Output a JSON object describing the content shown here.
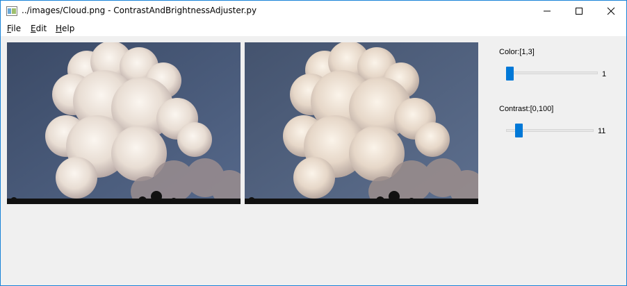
{
  "window": {
    "title": "../images/Cloud.png - ContrastAndBrightnessAdjuster.py",
    "icon": "app-window-icon",
    "controls": [
      "minimize-icon",
      "maximize-icon",
      "close-icon"
    ]
  },
  "menu": {
    "items": [
      {
        "accel": "F",
        "rest": "ile"
      },
      {
        "accel": "E",
        "rest": "dit"
      },
      {
        "accel": "H",
        "rest": "elp"
      }
    ]
  },
  "images": {
    "original": {
      "description_icon": "cloud-image"
    },
    "adjusted": {
      "description_icon": "cloud-image"
    }
  },
  "controls": {
    "color": {
      "label": "Color:[1,3]",
      "value": "1",
      "min": 1,
      "max": 3,
      "current": 1
    },
    "contrast": {
      "label": "Contrast:[0,100]",
      "value": "11",
      "min": 0,
      "max": 100,
      "current": 11
    }
  },
  "colors": {
    "accent": "#0078d7",
    "window_border": "#1883d7",
    "background": "#f0f0f0"
  }
}
